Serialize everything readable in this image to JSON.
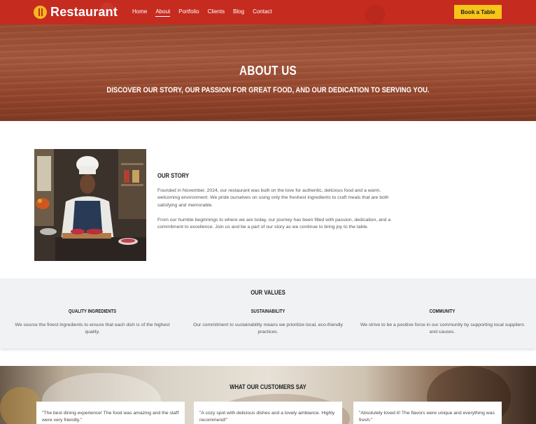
{
  "nav": {
    "logo_text": "Restaurant",
    "items": [
      {
        "label": "Home"
      },
      {
        "label": "About",
        "active": true
      },
      {
        "label": "Portfolio"
      },
      {
        "label": "Clients"
      },
      {
        "label": "Blog"
      },
      {
        "label": "Contact"
      }
    ],
    "book_label": "Book a Table",
    "accent_color": "#c62b20",
    "button_color": "#f5c518"
  },
  "hero": {
    "title": "ABOUT US",
    "subtitle": "DISCOVER OUR STORY, OUR PASSION FOR GREAT FOOD, AND OUR DEDICATION TO SERVING YOU."
  },
  "story": {
    "title": "OUR STORY",
    "paragraph1": "Founded in November, 2024, our restaurant was built on the love for authentic, delicious food and a warm, welcoming environment. We pride ourselves on using only the freshest ingredients to craft meals that are both satisfying and memorable.",
    "paragraph2": "From our humble beginnings to where we are today, our journey has been filled with passion, dedication, and a commitment to excellence. Join us and be a part of our story as we continue to bring joy to the table."
  },
  "values": {
    "title": "OUR VALUES",
    "items": [
      {
        "heading": "QUALITY INGREDIENTS",
        "text": "We source the finest ingredients to ensure that each dish is of the highest quality."
      },
      {
        "heading": "SUSTAINABILITY",
        "text": "Our commitment to sustainability means we prioritize local, eco-friendly practices."
      },
      {
        "heading": "COMMUNITY",
        "text": "We strive to be a positive force in our community by supporting local suppliers and causes."
      }
    ]
  },
  "testimonials": {
    "title": "WHAT OUR CUSTOMERS SAY",
    "items": [
      {
        "quote": "\"The best dining experience! The food was amazing and the staff were very friendly.\""
      },
      {
        "quote": "\"A cozy spot with delicious dishes and a lovely ambiance. Highly recommend!\""
      },
      {
        "quote": "\"Absolutely loved it! The flavors were unique and everything was fresh.\""
      }
    ]
  }
}
